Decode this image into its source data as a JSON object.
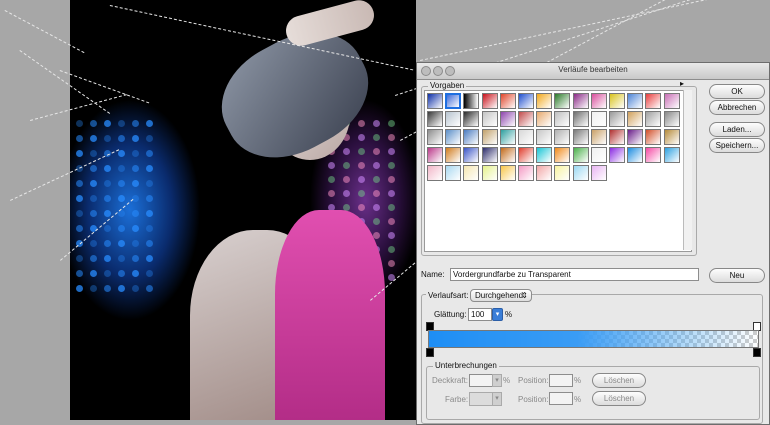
{
  "dialog": {
    "title": "Verläufe bearbeiten",
    "presets_label": "Vorgaben",
    "buttons": {
      "ok": "OK",
      "cancel": "Abbrechen",
      "load": "Laden...",
      "save": "Speichern...",
      "new": "Neu"
    },
    "name_label": "Name:",
    "name_value": "Vordergrundfarbe zu Transparent",
    "gradient_type_label": "Verlaufsart:",
    "gradient_type_value": "Durchgehend",
    "smoothness_label": "Glättung:",
    "smoothness_value": "100",
    "smoothness_unit": "%",
    "stops_group": "Unterbrechungen",
    "opacity_label": "Deckkraft:",
    "opacity_unit": "%",
    "position_label": "Position:",
    "position_unit": "%",
    "color_label": "Farbe:",
    "delete_label": "Löschen"
  },
  "accent_color": "#1e8ef5",
  "swatch_colors": [
    "#0d2fa8",
    "#3f6bd8",
    "#5a5a5a",
    "#c8111b",
    "#e0452a",
    "#1f4fcf",
    "#f2a81c",
    "#2c7a2a",
    "#8a2a86",
    "#d94f9c",
    "#d8c21c",
    "#4d84d6",
    "#e83e3e",
    "#c86fb5",
    "#3a3a3a",
    "#b7c4d0",
    "#2a2a2a",
    "#c4c4c4",
    "#8e44ad",
    "#c24c4c",
    "#e7a96e",
    "#bfbfbf",
    "#6e6e6e",
    "#f0f0f0",
    "#999999",
    "#d1a15c",
    "#a0a0a0",
    "#888888",
    "#8d8d8d",
    "#5c8fc9",
    "#4a7bc1",
    "#c1a16b",
    "#2e9f9f",
    "#d8d8d8",
    "#c7c7c7",
    "#b0b0b0",
    "#7a7a7a",
    "#c9a067",
    "#b03030",
    "#6a1e8a",
    "#d24f2a",
    "#b58b3a",
    "#bb3a8a",
    "#d07b1d",
    "#3a55c7",
    "#2d2d6b",
    "#c26a1a",
    "#e03e2e",
    "#18c6d6",
    "#f08a1a",
    "#4ab04a",
    "#f0f0f0",
    "#8a2be2",
    "#1c8ce0",
    "#f54aa4",
    "#2ca1e0",
    "#f2b6c8",
    "#a8d8f0",
    "#f5e6b0",
    "#e5f28c",
    "#f7c64a",
    "#f49ac4",
    "#f2a6a6",
    "#f7f3a0",
    "#9bd8f2",
    "#e8b4f2"
  ]
}
